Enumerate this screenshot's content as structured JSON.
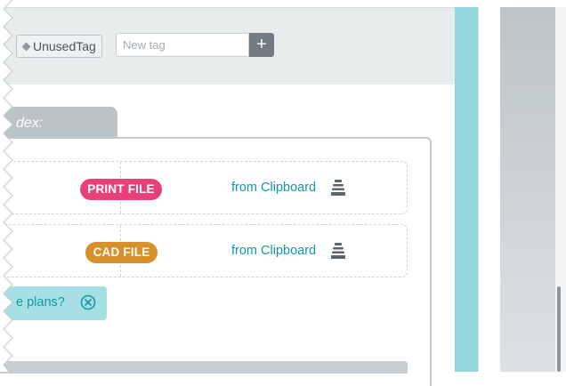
{
  "tags": {
    "existing_tag": "UnusedTag",
    "new_tag_placeholder": "New tag",
    "add_button": "+"
  },
  "index": {
    "tab_label": "dex:"
  },
  "file_rows": [
    {
      "badge": "PRINT FILE",
      "badge_color": "#e8417a",
      "source": "from Clipboard",
      "icon": "clipboard-stack-icon"
    },
    {
      "badge": "CAD FILE",
      "badge_color": "#d8902a",
      "source": "from Clipboard",
      "icon": "clipboard-stack-icon"
    }
  ],
  "question": {
    "text": "e plans?",
    "icon": "close-circle-icon"
  },
  "colors": {
    "accent_teal": "#1497a3",
    "teal_strip": "#92d6dd",
    "tag_bar_bg": "#e9eced"
  }
}
